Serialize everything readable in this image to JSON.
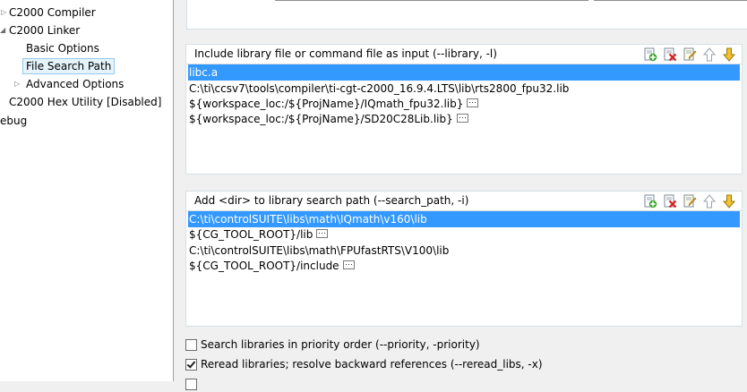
{
  "colors": {
    "selection": "#3399ff",
    "tree_selection_bg": "#e5f3fb",
    "tree_selection_border": "#99c7ee",
    "panel_bg": "#f0f0f0"
  },
  "tree": {
    "items": [
      {
        "label": "C2000 Compiler",
        "twist": "expand-arrow"
      },
      {
        "label": "C2000 Linker",
        "twist": "collapse-arrow"
      },
      {
        "label": "Basic Options"
      },
      {
        "label": "File Search Path"
      },
      {
        "label": "Advanced Options",
        "twist": "expand-arrow"
      },
      {
        "label": "C2000 Hex Utility  [Disabled]"
      },
      {
        "label": "ebug"
      }
    ]
  },
  "library": {
    "title": "Include library file or command file as input (--library, -l)",
    "tools": [
      "add-icon",
      "delete-icon",
      "edit-icon",
      "move-up-icon",
      "move-down-icon"
    ],
    "items": [
      {
        "text": "libc.a",
        "selected": true,
        "more": false
      },
      {
        "text": "C:\\ti\\ccsv7\\tools\\compiler\\ti-cgt-c2000_16.9.4.LTS\\lib\\rts2800_fpu32.lib",
        "selected": false,
        "more": false
      },
      {
        "text": "${workspace_loc:/${ProjName}/IQmath_fpu32.lib}",
        "selected": false,
        "more": true
      },
      {
        "text": "${workspace_loc:/${ProjName}/SD20C28Lib.lib}",
        "selected": false,
        "more": true
      }
    ]
  },
  "search": {
    "title": "Add <dir> to library search path (--search_path, -i)",
    "tools": [
      "add-icon",
      "delete-icon",
      "edit-icon",
      "move-up-icon",
      "move-down-icon"
    ],
    "items": [
      {
        "text": "C:\\ti\\controlSUITE\\libs\\math\\IQmath\\v160\\lib",
        "selected": true,
        "more": false
      },
      {
        "text": "${CG_TOOL_ROOT}/lib",
        "selected": false,
        "more": true
      },
      {
        "text": "C:\\ti\\controlSUITE\\libs\\math\\FPUfastRTS\\V100\\lib",
        "selected": false,
        "more": false
      },
      {
        "text": "${CG_TOOL_ROOT}/include",
        "selected": false,
        "more": true
      }
    ]
  },
  "options": [
    {
      "label": "Search libraries in priority order (--priority, -priority)",
      "checked": false
    },
    {
      "label": "Reread libraries; resolve backward references (--reread_libs, -x)",
      "checked": true
    },
    {
      "label": "",
      "checked": false
    }
  ]
}
